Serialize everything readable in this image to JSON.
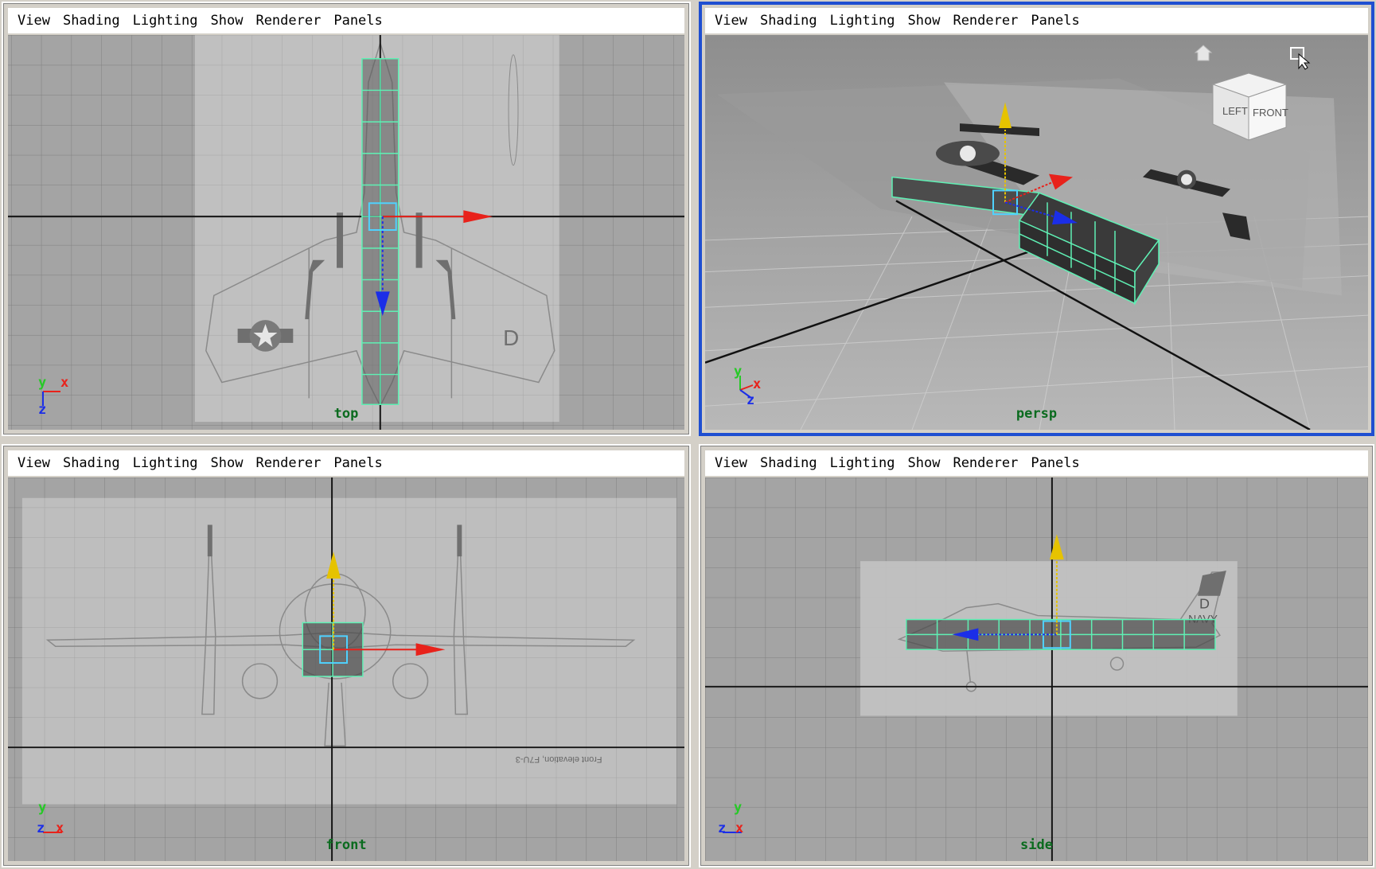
{
  "menu": [
    "View",
    "Shading",
    "Lighting",
    "Show",
    "Renderer",
    "Panels"
  ],
  "panes": {
    "top": {
      "camera": "top",
      "axes": [
        "y",
        "x",
        "z"
      ]
    },
    "persp": {
      "camera": "persp",
      "axes": [
        "y",
        "x",
        "z"
      ],
      "cube": {
        "left": "LEFT",
        "front": "FRONT"
      }
    },
    "front": {
      "camera": "front",
      "axes": [
        "y",
        "z",
        "x"
      ],
      "caption": "Front elevation, F7U-3"
    },
    "side": {
      "camera": "side",
      "axes": [
        "y",
        "z",
        "x"
      ],
      "decals": {
        "letter": "D",
        "navy": "NAVY"
      }
    }
  },
  "colors": {
    "axis_x": "#e8221b",
    "axis_y": "#27c927",
    "axis_z": "#1b2ee8",
    "wireframe": "#5ff0b4",
    "active_border": "#1f4fd1",
    "camera_label": "#0b6b1f"
  }
}
